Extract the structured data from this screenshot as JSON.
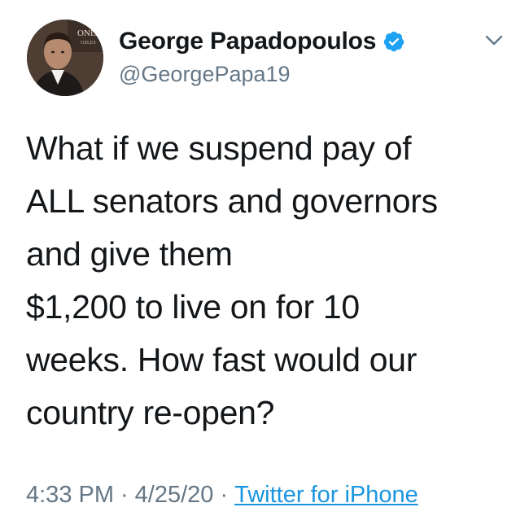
{
  "user": {
    "display_name": "George Papadopoulos",
    "handle": "@GeorgePapa19",
    "verified_icon": "verified-badge-icon",
    "avatar_text": "ONIST",
    "avatar_subtext": "GELES"
  },
  "tweet": {
    "lines": [
      "What if we suspend pay of",
      "ALL senators and governors",
      "and give them",
      "$1,200 to live on for 10",
      "weeks. How fast would our",
      "country re-open?"
    ]
  },
  "meta": {
    "time": "4:33 PM",
    "separator": "·",
    "date": "4/25/20",
    "source": "Twitter for iPhone"
  },
  "icons": {
    "menu": "chevron-down-icon"
  },
  "colors": {
    "text": "#14171a",
    "secondary": "#657786",
    "link": "#1b95e0",
    "verified": "#1da1f2"
  }
}
